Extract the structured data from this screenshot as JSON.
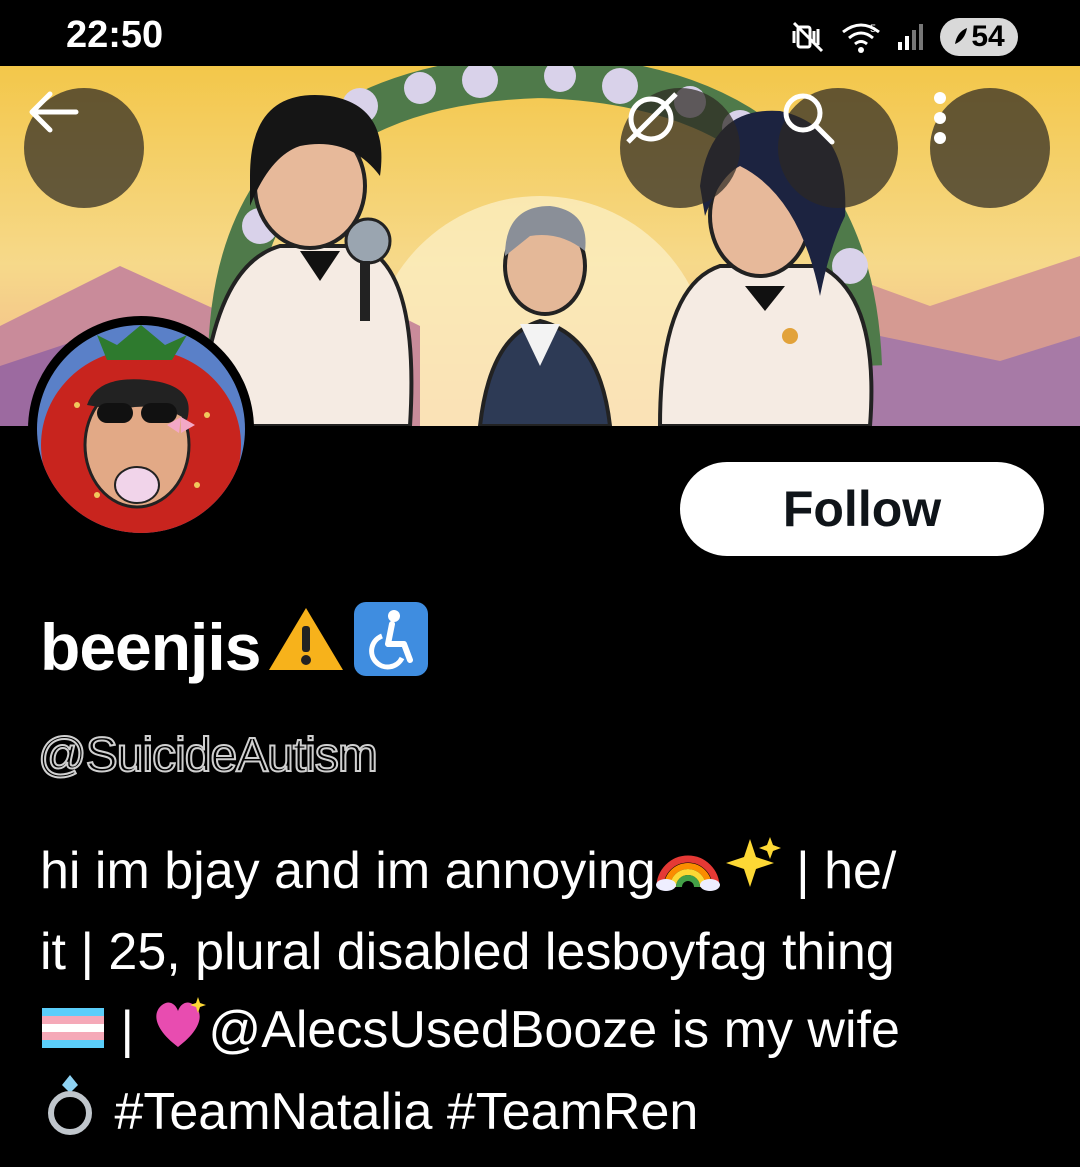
{
  "status_bar": {
    "time": "22:50",
    "battery_level": "54",
    "icons": [
      "mute-vibrate-icon",
      "wifi-icon",
      "signal-icon",
      "battery-icon"
    ]
  },
  "header": {
    "icons": [
      "back-arrow-icon",
      "grok-icon",
      "search-icon",
      "more-vertical-icon"
    ]
  },
  "profile": {
    "display_name": "beenjis",
    "name_badges": [
      "warning-icon",
      "wheelchair-icon"
    ],
    "handle": "@SuicideAutism",
    "follow_label": "Follow",
    "bio": {
      "line1_text": "hi im bjay and im annoying",
      "line1_tail": " | he/",
      "line2": "it | 25, plural disabled lesboyfag thing",
      "line3_sep": " | ",
      "line3_mention": "@AlecsUsedBooze is my wife",
      "line4_tags": " #TeamNatalia #TeamRen",
      "emojis": [
        "rainbow-icon",
        "sparkles-icon",
        "trans-flag-icon",
        "sparkling-heart-icon",
        "ring-icon"
      ]
    }
  },
  "colors": {
    "background": "#000000",
    "follow_bg": "#ffffff",
    "follow_text": "#0f1419",
    "text": "#ffffff",
    "handle_text": "#d0d0d0"
  }
}
